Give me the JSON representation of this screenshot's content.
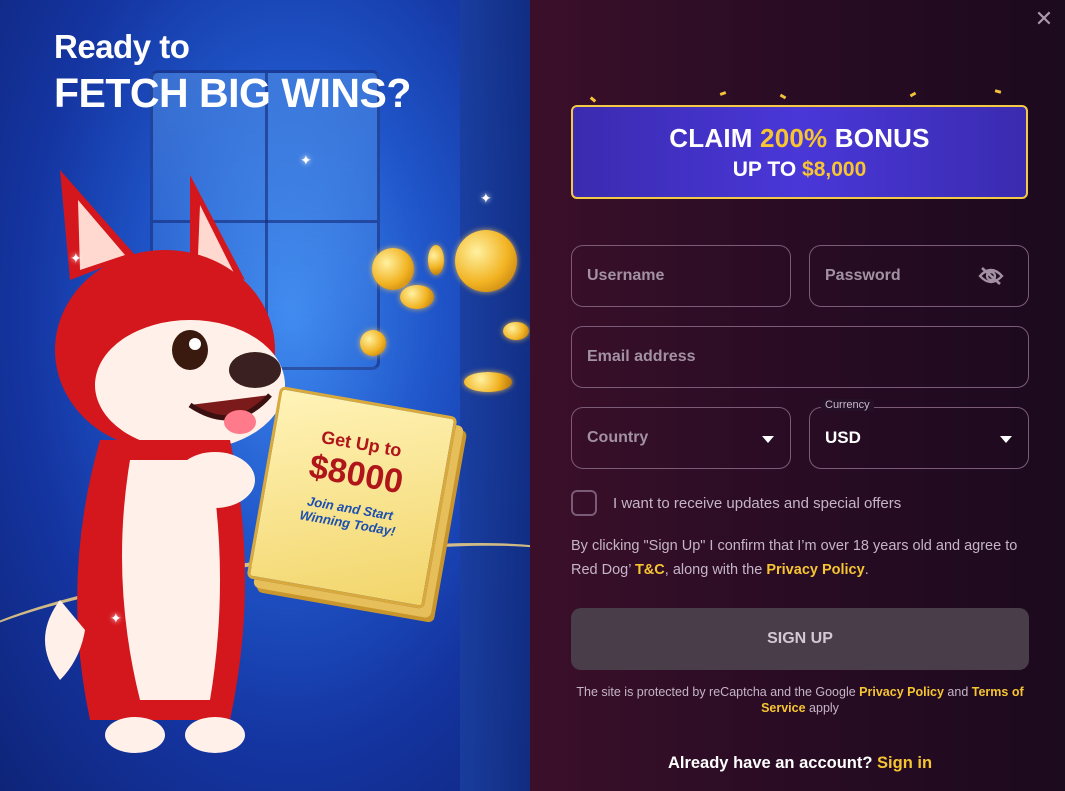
{
  "promo": {
    "title_line1": "Ready to",
    "title_line2": "FETCH BIG WINS?",
    "book_line1": "Get Up to",
    "book_line2": "$8000",
    "book_line3": "Join and Start Winning Today!"
  },
  "bonus": {
    "claim": "CLAIM",
    "percent": "200%",
    "bonus_word": "BONUS",
    "up_to": "UP TO",
    "amount": "$8,000"
  },
  "form": {
    "username_placeholder": "Username",
    "password_placeholder": "Password",
    "email_placeholder": "Email address",
    "country_placeholder": "Country",
    "currency_label": "Currency",
    "currency_value": "USD",
    "updates_label": "I want to receive updates and special offers",
    "legal_text_1": "By clicking \"Sign Up\" I confirm that I’m over 18 years old and agree to Red Dog’ ",
    "legal_tc": "T&C",
    "legal_text_2": ", along with the ",
    "legal_privacy": "Privacy Policy",
    "legal_text_3": ".",
    "signup_label": "SIGN UP",
    "recaptcha_text_1": "The site is protected by reCaptcha and the Google ",
    "recaptcha_privacy": "Privacy Policy",
    "recaptcha_text_2": " and ",
    "recaptcha_terms": "Terms of Service",
    "recaptcha_text_3": " apply",
    "have_account": "Already have an account?",
    "sign_in": "Sign in"
  },
  "icons": {
    "close": "close-icon",
    "eye": "eye-off-icon",
    "caret": "chevron-down-icon"
  },
  "colors": {
    "accent_yellow": "#f6c531",
    "panel_bg": "#2a0c24",
    "promo_blue": "#1f55c9",
    "bonus_purple": "#4a37d8",
    "button_disabled": "#4a3d4a"
  }
}
